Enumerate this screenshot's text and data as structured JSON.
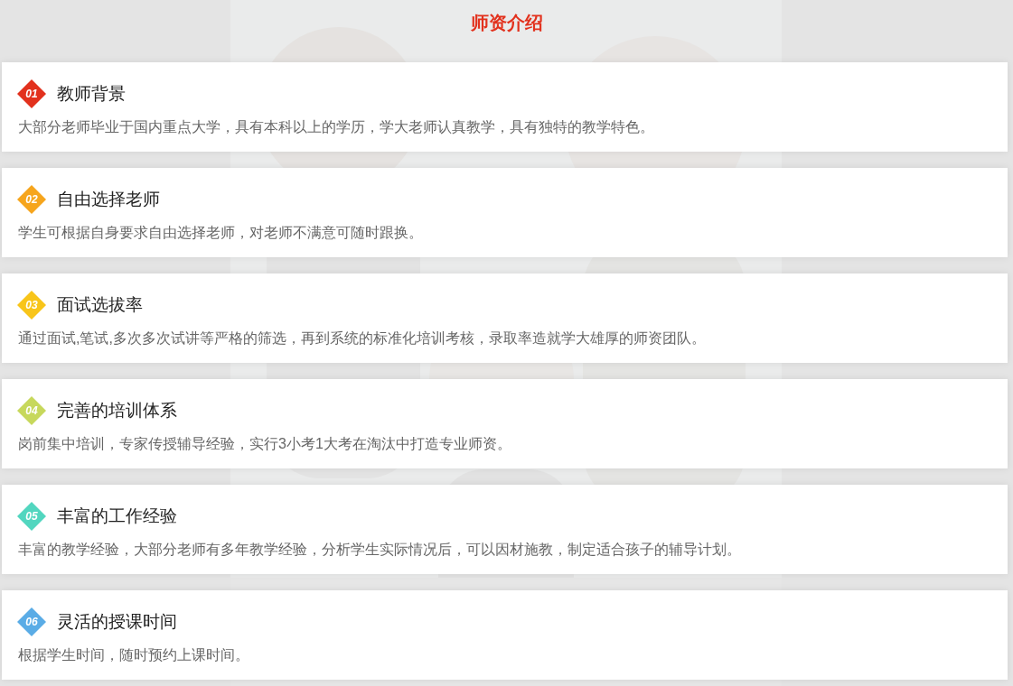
{
  "heading": "师资介绍",
  "items": [
    {
      "number": "01",
      "color": "#e2311d",
      "title": "教师背景",
      "description": "大部分老师毕业于国内重点大学，具有本科以上的学历，学大老师认真教学，具有独特的教学特色。"
    },
    {
      "number": "02",
      "color": "#f6a51d",
      "title": "自由选择老师",
      "description": "学生可根据自身要求自由选择老师，对老师不满意可随时跟换。"
    },
    {
      "number": "03",
      "color": "#f8c51a",
      "title": "面试选拔率",
      "description": "通过面试,笔试,多次多次试讲等严格的筛选，再到系统的标准化培训考核，录取率造就学大雄厚的师资团队。"
    },
    {
      "number": "04",
      "color": "#c7d85c",
      "title": "完善的培训体系",
      "description": "岗前集中培训，专家传授辅导经验，实行3小考1大考在淘汰中打造专业师资。"
    },
    {
      "number": "05",
      "color": "#52d6bf",
      "title": "丰富的工作经验",
      "description": "丰富的教学经验，大部分老师有多年教学经验，分析学生实际情况后，可以因材施教，制定适合孩子的辅导计划。"
    },
    {
      "number": "06",
      "color": "#5aace6",
      "title": "灵活的授课时间",
      "description": "根据学生时间，随时预约上课时间。"
    }
  ]
}
